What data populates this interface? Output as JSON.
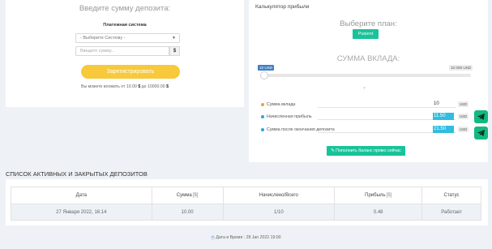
{
  "deposit": {
    "title": "Введите сумму депозита:",
    "payment_system_label": "Платежная система",
    "select_value": "- Выберите Систему -",
    "amount_placeholder": "Введите сумму...",
    "currency_symbol": "$",
    "register_button": "Зарегистрировать",
    "limits_prefix": "Вы можете вложить от 10.00",
    "limits_cur1": "$",
    "limits_middle": "до 10000.00",
    "limits_cur2": "$"
  },
  "calculator": {
    "title": "Калькулятор прибыли",
    "plan_title": "Выберите план:",
    "plan_button": "Pusient",
    "sum_title": "СУММА ВКЛАДА:",
    "range_min": "10 USD",
    "range_max": "10 000 USD",
    "slider_fraction": 0,
    "rows": [
      {
        "label": "Сумма вклада",
        "value": "10",
        "unit": "USD",
        "color": "#f0a030",
        "highlight": false
      },
      {
        "label": "Начисленная прибыль",
        "value": "11.50",
        "unit": "USD",
        "color": "#2fa0e0",
        "highlight": true
      },
      {
        "label": "Сумма после окончания депозита",
        "value": "21.50",
        "unit": "USD",
        "color": "#2fa0e0",
        "highlight": true
      }
    ],
    "refill_button": "Пополнить баланс прямо сейчас"
  },
  "deposits_list": {
    "title": "СПИСОК АКТИВНЫХ И ЗАКРЫТЫХ ДЕПОЗИТОВ",
    "columns": [
      "Дата",
      "Сумма",
      "Начислено/Всего",
      "Прибыль",
      "Статус"
    ],
    "rows": [
      [
        "27 Января 2022, 16:14",
        "10.00",
        "1/10",
        "0.48",
        "Работает"
      ]
    ]
  },
  "footer": {
    "text": "Дата и Время : 28 Jan 2022 19:00"
  },
  "colors": {
    "accent_green": "#19c39a",
    "accent_yellow": "#f7c93b",
    "accent_blue": "#3d7fc7",
    "telegram_green": "#12b981"
  }
}
